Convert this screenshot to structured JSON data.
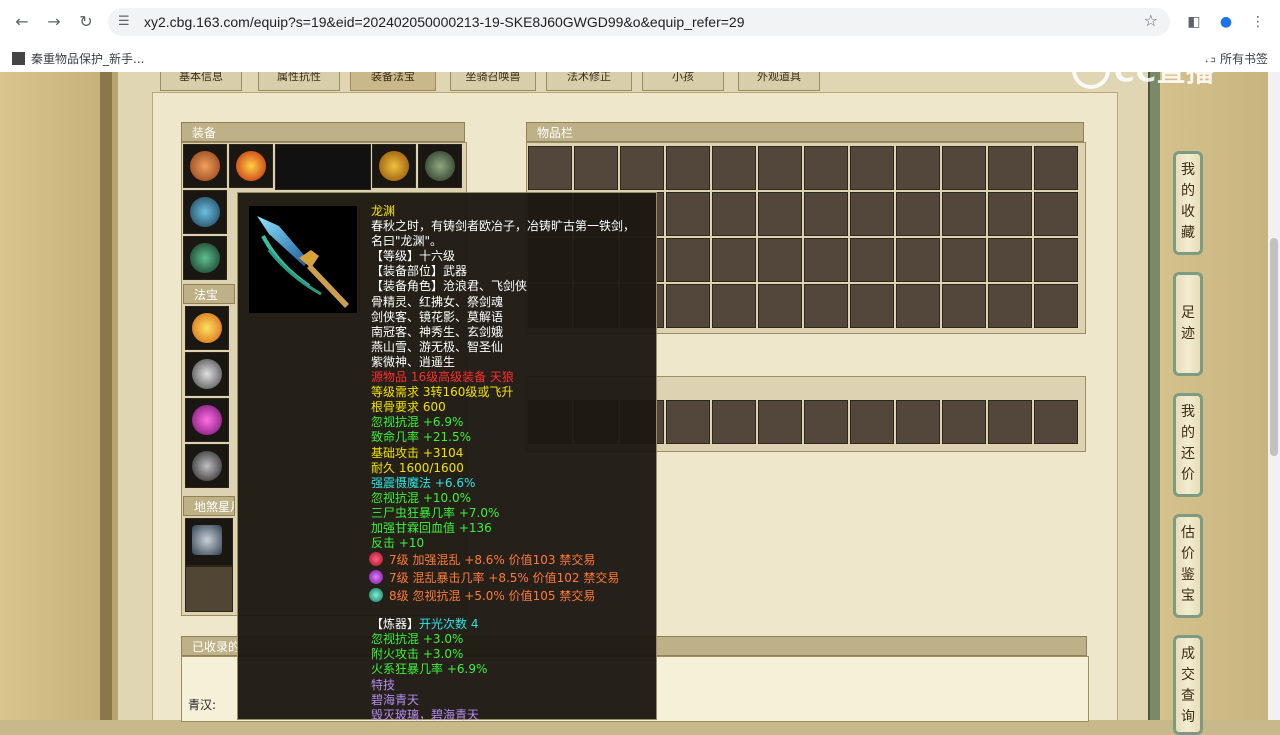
{
  "browser": {
    "url": "xy2.cbg.163.com/equip?s=19&eid=202402050000213-19-SKE8J60GWGD99&o&equip_refer=29",
    "bookmark_label": "秦重物品保护_新手...",
    "all_bookmarks_label": "所有书签",
    "watermark_text": "CC直播"
  },
  "tabs": [
    "基本信息",
    "属性抗性",
    "装备法宝",
    "坐骑召唤兽",
    "法术修正",
    "小孩",
    "外观道具"
  ],
  "sections": {
    "equipment": "装备",
    "fabao": "法宝",
    "disha": "地煞星月",
    "inventory": "物品栏",
    "collected": "已收录的",
    "qinghan": "青汉:"
  },
  "side_buttons": [
    "我的收藏",
    "足迹",
    "我的还价",
    "估价鉴宝",
    "成交查询"
  ],
  "tooltip": {
    "name": "龙渊",
    "desc_lines": [
      "春秋之时，有铸剑者欧冶子，冶铸旷古第一铁剑，",
      "名曰\"龙渊\"。"
    ],
    "level": "【等级】十六级",
    "slot": "【装备部位】武器",
    "roles_lines": [
      "【装备角色】沧浪君、飞剑侠",
      "骨精灵、红拂女、祭剑魂",
      "剑侠客、镜花影、莫解语",
      "南冠客、神秀生、玄剑娥",
      "燕山雪、游无极、智圣仙",
      "紫微神、逍遥生"
    ],
    "source": "源物品 16级高级装备 天狼",
    "req_level": "等级需求 3转160级或飞升",
    "req_bone": "根骨要求 600",
    "base_stats": [
      "忽视抗混 +6.9%",
      "致命几率 +21.5%",
      "基础攻击 +3104",
      "耐久 1600/1600"
    ],
    "magic_stat": "强震慑魔法 +6.6%",
    "bonus_stats": [
      "忽视抗混 +10.0%",
      "三尸虫狂暴几率 +7.0%",
      "加强甘霖回血值 +136",
      "反击 +10"
    ],
    "gems": [
      {
        "text": "7级 加强混乱 +8.6% 价值103 禁交易",
        "color": "#e8203a"
      },
      {
        "text": "7级 混乱暴击几率 +8.5% 价值102 禁交易",
        "color": "#c040e0"
      },
      {
        "text": "8级 忽视抗混 +5.0% 价值105 禁交易",
        "color": "#30b090"
      }
    ],
    "refine_label": "【炼器】",
    "refine_count": "开光次数 4",
    "refine_stats": [
      "忽视抗混 +3.0%",
      "附火攻击 +3.0%",
      "火系狂暴几率 +6.9%"
    ],
    "special_label": "特技",
    "special_lines": [
      "碧海青天",
      "毁灭玻璃，碧海青天"
    ]
  }
}
